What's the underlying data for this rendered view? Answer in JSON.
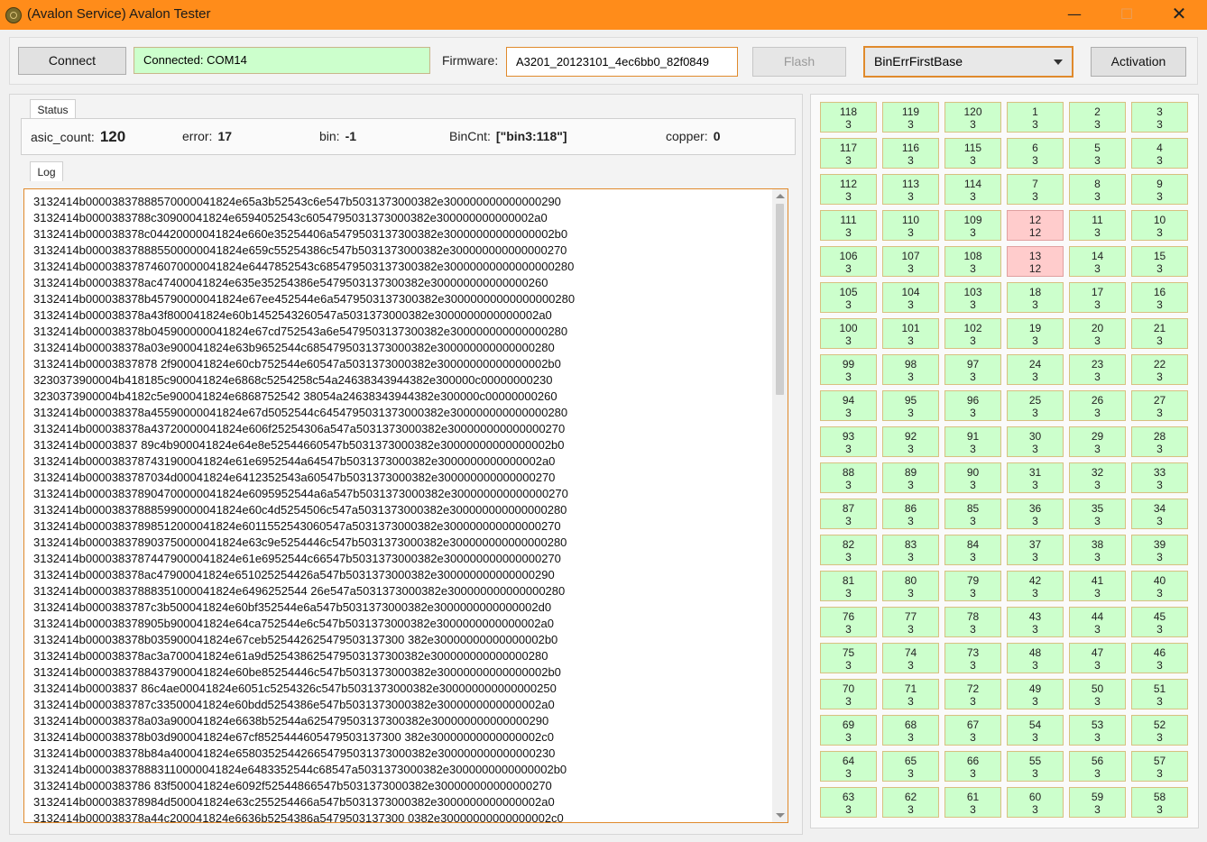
{
  "window": {
    "title": "(Avalon Service) Avalon Tester",
    "minimize": "—",
    "maximize": "☐",
    "close": "✕"
  },
  "toolbar": {
    "connect_label": "Connect",
    "connection_status": "Connected: COM14",
    "firmware_label": "Firmware:",
    "firmware_value": "A3201_20123101_4ec6bb0_82f0849",
    "flash_label": "Flash",
    "mode_selected": "BinErrFirstBase",
    "activation_label": "Activation"
  },
  "status": {
    "tab_label": "Status",
    "asic_count_label": "asic_count:",
    "asic_count": "120",
    "error_label": "error:",
    "error": "17",
    "bin_label": "bin:",
    "bin": "-1",
    "bincnt_label": "BinCnt:",
    "bincnt": "[\"bin3:118\"]",
    "copper_label": "copper:",
    "copper": "0"
  },
  "log": {
    "tab_label": "Log",
    "lines": [
      "3132414b00003837888570000041824e65a3b52543c6e547b5031373000382e300000000000000290",
      "3132414b0000383788c30900041824e6594052543c6054795031373000382e300000000000002a0",
      "3132414b000038378c04420000041824e660e35254406a5479503137300382e30000000000000002b0",
      "3132414b000038378885500000041824e659c55254386c547b5031373000382e300000000000000270",
      "3132414b000038378746070000041824e6447852543c685479503137300382e30000000000000000280",
      "3132414b000038378ac47400041824e635e35254386e5479503137300382e300000000000000260",
      "3132414b000038378b45790000041824e67ee452544e6a5479503137300382e30000000000000000280",
      "3132414b000038378a43f800041824e60b1452543260547a5031373000382e3000000000000002a0",
      "3132414b000038378b045900000041824e67cd752543a6e5479503137300382e300000000000000280",
      "3132414b000038378a03e900041824e63b9652544c6854795031373000382e300000000000000280",
      "3132414b00003837878 2f900041824e60cb752544e60547a5031373000382e30000000000000002b0",
      "3230373900004b418185c900041824e6868c5254258c54a24638343944382e300000c00000000230",
      "3230373900004b4182c5e900041824e6868752542 38054a24638343944382e300000c00000000260",
      "3132414b000038378a45590000041824e67d5052544c6454795031373000382e300000000000000280",
      "3132414b000038378a43720000041824e606f25254306a547a5031373000382e300000000000000270",
      "3132414b00003837 89c4b900041824e64e8e52544660547b5031373000382e30000000000000002b0",
      "3132414b0000383787431900041824e61e6952544a64547b5031373000382e3000000000000002a0",
      "3132414b0000383787034d00041824e6412352543a60547b5031373000382e300000000000000270",
      "3132414b000038378904700000041824e6095952544a6a547b5031373000382e300000000000000270",
      "3132414b000038378885990000041824e60c4d5254506c547a5031373000382e300000000000000280",
      "3132414b00003837898512000041824e6011552543060547a5031373000382e300000000000000270",
      "3132414b000038378903750000041824e63c9e5254446c547b5031373000382e300000000000000280",
      "3132414b00003837874479000041824e61e6952544c66547b5031373000382e300000000000000270",
      "3132414b000038378ac47900041824e651025254426a547b5031373000382e300000000000000290",
      "3132414b00003837888351000041824e6496252544 26e547a5031373000382e300000000000000280",
      "3132414b0000383787c3b500041824e60bf352544e6a547b5031373000382e3000000000000002d0",
      "3132414b000038378905b900041824e64ca752544e6c547b5031373000382e3000000000000002a0",
      "3132414b000038378b035900041824e67ceb525442625479503137300 382e30000000000000002b0",
      "3132414b000038378ac3a700041824e61a9d525438625479503137300382e300000000000000280",
      "3132414b0000383788437900041824e60be85254446c547b5031373000382e30000000000000002b0",
      "3132414b00003837 86c4ae00041824e6051c5254326c547b5031373000382e300000000000000250",
      "3132414b0000383787c33500041824e60bdd5254386e547b5031373000382e3000000000000002a0",
      "3132414b000038378a03a900041824e6638b52544a625479503137300382e300000000000000290",
      "3132414b000038378b03d900041824e67cf8525444605479503137300 382e30000000000000002c0",
      "3132414b000038378b84a400041824e658035254426654795031373000382e300000000000000230",
      "3132414b000038378883110000041824e6483352544c68547a5031373000382e3000000000000002b0",
      "3132414b0000383786 83f500041824e6092f52544866547b5031373000382e300000000000000270",
      "3132414b000038378984d500041824e63c255254466a547b5031373000382e3000000000000002a0",
      "3132414b000038378a44c200041824e6636b5254386a5479503137300 0382e30000000000000002c0"
    ]
  },
  "grid": {
    "cells": [
      {
        "id": "118",
        "v": "3"
      },
      {
        "id": "119",
        "v": "3"
      },
      {
        "id": "120",
        "v": "3"
      },
      {
        "id": "1",
        "v": "3"
      },
      {
        "id": "2",
        "v": "3"
      },
      {
        "id": "3",
        "v": "3"
      },
      {
        "id": "117",
        "v": "3"
      },
      {
        "id": "116",
        "v": "3"
      },
      {
        "id": "115",
        "v": "3"
      },
      {
        "id": "6",
        "v": "3"
      },
      {
        "id": "5",
        "v": "3"
      },
      {
        "id": "4",
        "v": "3"
      },
      {
        "id": "112",
        "v": "3"
      },
      {
        "id": "113",
        "v": "3"
      },
      {
        "id": "114",
        "v": "3"
      },
      {
        "id": "7",
        "v": "3"
      },
      {
        "id": "8",
        "v": "3"
      },
      {
        "id": "9",
        "v": "3"
      },
      {
        "id": "111",
        "v": "3"
      },
      {
        "id": "110",
        "v": "3"
      },
      {
        "id": "109",
        "v": "3"
      },
      {
        "id": "12",
        "v": "12",
        "err": true
      },
      {
        "id": "11",
        "v": "3"
      },
      {
        "id": "10",
        "v": "3"
      },
      {
        "id": "106",
        "v": "3"
      },
      {
        "id": "107",
        "v": "3"
      },
      {
        "id": "108",
        "v": "3"
      },
      {
        "id": "13",
        "v": "12",
        "err": true
      },
      {
        "id": "14",
        "v": "3"
      },
      {
        "id": "15",
        "v": "3"
      },
      {
        "id": "105",
        "v": "3"
      },
      {
        "id": "104",
        "v": "3"
      },
      {
        "id": "103",
        "v": "3"
      },
      {
        "id": "18",
        "v": "3"
      },
      {
        "id": "17",
        "v": "3"
      },
      {
        "id": "16",
        "v": "3"
      },
      {
        "id": "100",
        "v": "3"
      },
      {
        "id": "101",
        "v": "3"
      },
      {
        "id": "102",
        "v": "3"
      },
      {
        "id": "19",
        "v": "3"
      },
      {
        "id": "20",
        "v": "3"
      },
      {
        "id": "21",
        "v": "3"
      },
      {
        "id": "99",
        "v": "3"
      },
      {
        "id": "98",
        "v": "3"
      },
      {
        "id": "97",
        "v": "3"
      },
      {
        "id": "24",
        "v": "3"
      },
      {
        "id": "23",
        "v": "3"
      },
      {
        "id": "22",
        "v": "3"
      },
      {
        "id": "94",
        "v": "3"
      },
      {
        "id": "95",
        "v": "3"
      },
      {
        "id": "96",
        "v": "3"
      },
      {
        "id": "25",
        "v": "3"
      },
      {
        "id": "26",
        "v": "3"
      },
      {
        "id": "27",
        "v": "3"
      },
      {
        "id": "93",
        "v": "3"
      },
      {
        "id": "92",
        "v": "3"
      },
      {
        "id": "91",
        "v": "3"
      },
      {
        "id": "30",
        "v": "3"
      },
      {
        "id": "29",
        "v": "3"
      },
      {
        "id": "28",
        "v": "3"
      },
      {
        "id": "88",
        "v": "3"
      },
      {
        "id": "89",
        "v": "3"
      },
      {
        "id": "90",
        "v": "3"
      },
      {
        "id": "31",
        "v": "3"
      },
      {
        "id": "32",
        "v": "3"
      },
      {
        "id": "33",
        "v": "3"
      },
      {
        "id": "87",
        "v": "3"
      },
      {
        "id": "86",
        "v": "3"
      },
      {
        "id": "85",
        "v": "3"
      },
      {
        "id": "36",
        "v": "3"
      },
      {
        "id": "35",
        "v": "3"
      },
      {
        "id": "34",
        "v": "3"
      },
      {
        "id": "82",
        "v": "3"
      },
      {
        "id": "83",
        "v": "3"
      },
      {
        "id": "84",
        "v": "3"
      },
      {
        "id": "37",
        "v": "3"
      },
      {
        "id": "38",
        "v": "3"
      },
      {
        "id": "39",
        "v": "3"
      },
      {
        "id": "81",
        "v": "3"
      },
      {
        "id": "80",
        "v": "3"
      },
      {
        "id": "79",
        "v": "3"
      },
      {
        "id": "42",
        "v": "3"
      },
      {
        "id": "41",
        "v": "3"
      },
      {
        "id": "40",
        "v": "3"
      },
      {
        "id": "76",
        "v": "3"
      },
      {
        "id": "77",
        "v": "3"
      },
      {
        "id": "78",
        "v": "3"
      },
      {
        "id": "43",
        "v": "3"
      },
      {
        "id": "44",
        "v": "3"
      },
      {
        "id": "45",
        "v": "3"
      },
      {
        "id": "75",
        "v": "3"
      },
      {
        "id": "74",
        "v": "3"
      },
      {
        "id": "73",
        "v": "3"
      },
      {
        "id": "48",
        "v": "3"
      },
      {
        "id": "47",
        "v": "3"
      },
      {
        "id": "46",
        "v": "3"
      },
      {
        "id": "70",
        "v": "3"
      },
      {
        "id": "71",
        "v": "3"
      },
      {
        "id": "72",
        "v": "3"
      },
      {
        "id": "49",
        "v": "3"
      },
      {
        "id": "50",
        "v": "3"
      },
      {
        "id": "51",
        "v": "3"
      },
      {
        "id": "69",
        "v": "3"
      },
      {
        "id": "68",
        "v": "3"
      },
      {
        "id": "67",
        "v": "3"
      },
      {
        "id": "54",
        "v": "3"
      },
      {
        "id": "53",
        "v": "3"
      },
      {
        "id": "52",
        "v": "3"
      },
      {
        "id": "64",
        "v": "3"
      },
      {
        "id": "65",
        "v": "3"
      },
      {
        "id": "66",
        "v": "3"
      },
      {
        "id": "55",
        "v": "3"
      },
      {
        "id": "56",
        "v": "3"
      },
      {
        "id": "57",
        "v": "3"
      },
      {
        "id": "63",
        "v": "3"
      },
      {
        "id": "62",
        "v": "3"
      },
      {
        "id": "61",
        "v": "3"
      },
      {
        "id": "60",
        "v": "3"
      },
      {
        "id": "59",
        "v": "3"
      },
      {
        "id": "58",
        "v": "3"
      }
    ],
    "colors": {
      "ok": "#ccffcc",
      "error": "#ffcccc"
    }
  }
}
